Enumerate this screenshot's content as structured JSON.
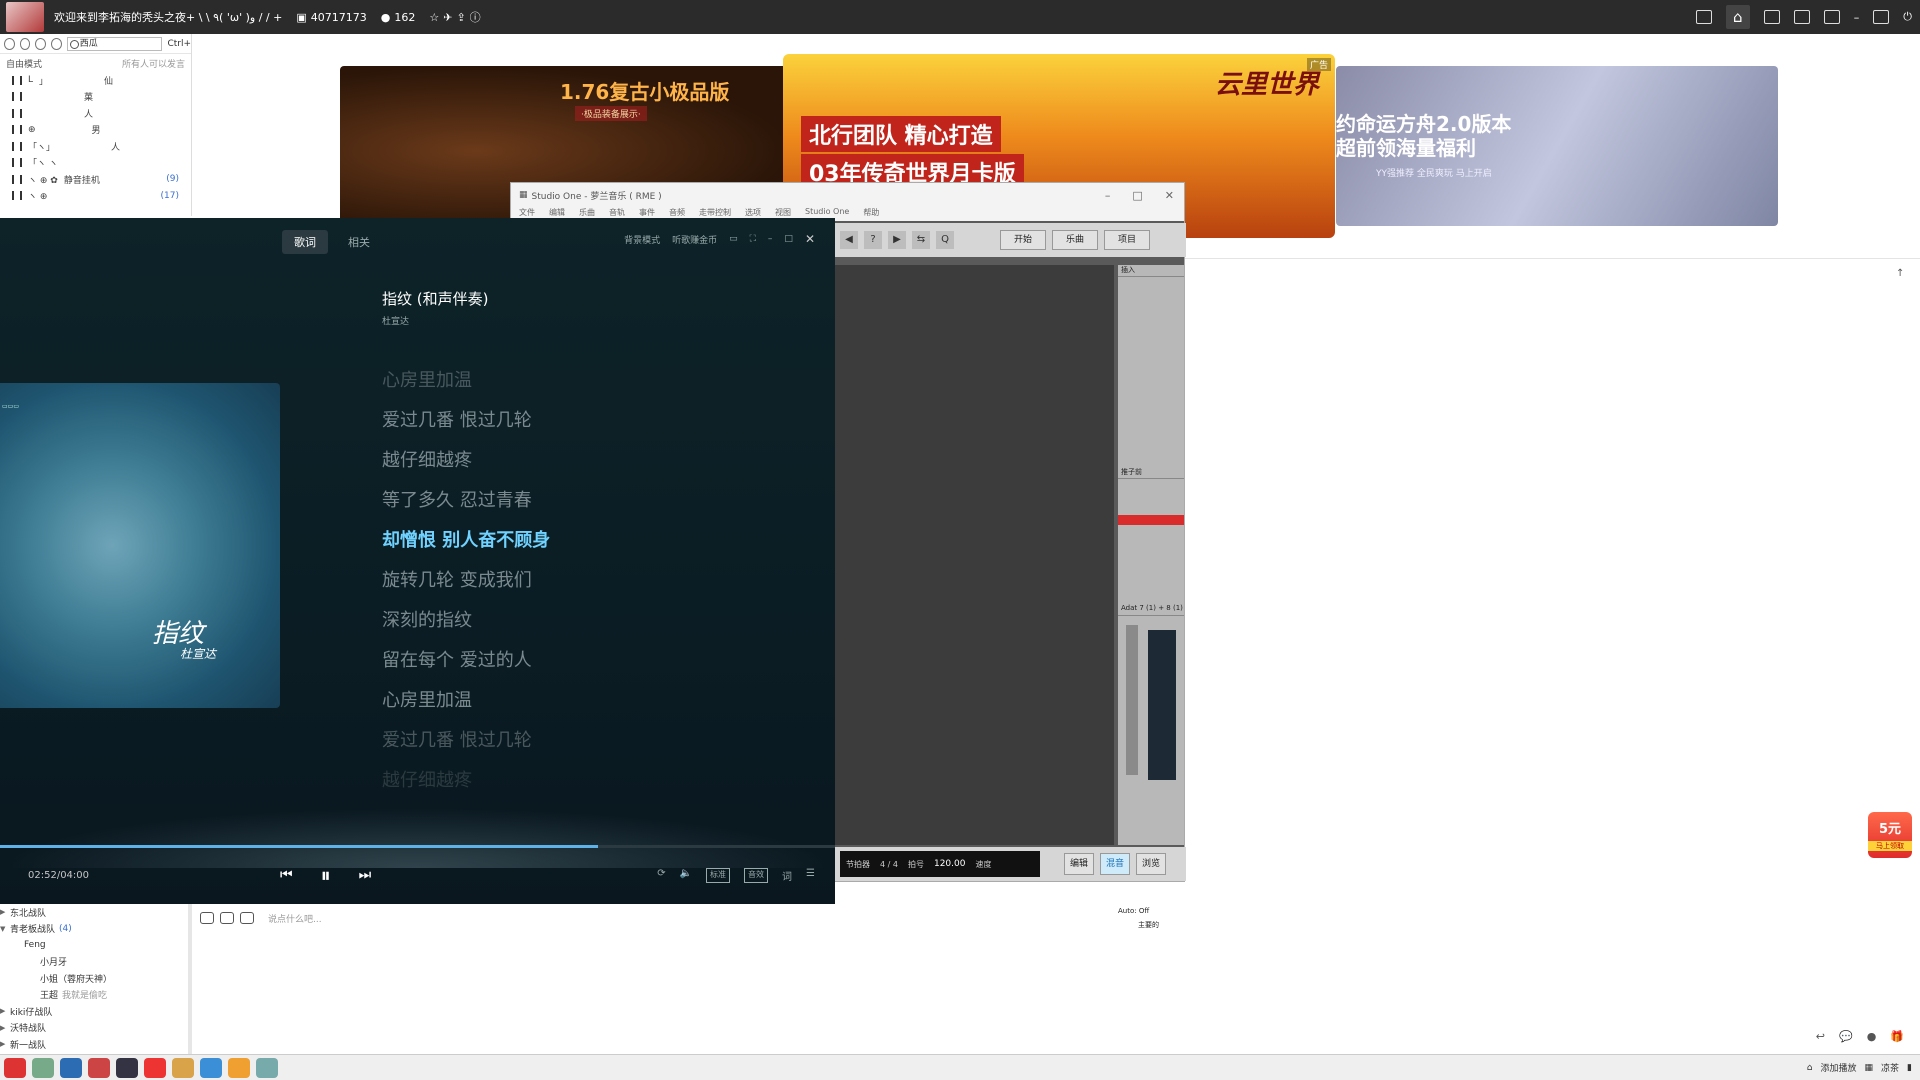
{
  "topbar": {
    "title": "欢迎来到李拓海的秃头之夜+ \\ \\ ٩( 'ω' )و / / +",
    "room_id": "40717173",
    "viewers": "162",
    "icons": [
      "screen-record-icon",
      "home-icon",
      "list-icon",
      "game-icon",
      "download-icon",
      "minimize-icon",
      "restore-icon",
      "power-icon"
    ]
  },
  "leftpanel": {
    "search_text": "西瓜",
    "search_shortcut": "Ctrl+",
    "mode_label": "自由模式",
    "mode_hint": "所有人可以发言",
    "rows": [
      {
        "c1": "L",
        "c2": "」",
        "c3": "仙",
        "cnt": ""
      },
      {
        "c1": "",
        "c2": "",
        "c3": "菓",
        "cnt": ""
      },
      {
        "c1": "",
        "c2": "",
        "c3": "人",
        "cnt": ""
      },
      {
        "c1": "⊕",
        "c2": "",
        "c3": "男",
        "cnt": ""
      },
      {
        "c1": "「ヽ」",
        "c2": "",
        "c3": "人",
        "cnt": ""
      },
      {
        "c1": "「ヽ  ヽ",
        "c2": "",
        "c3": "",
        "cnt": ""
      },
      {
        "c1": "ヽ ⊕ ✿",
        "c2": "静音挂机",
        "c3": "",
        "cnt": "(9)"
      },
      {
        "c1": "ヽ ⊕",
        "c2": "",
        "c3": "",
        "cnt": "(17)"
      }
    ]
  },
  "ads": {
    "ad1_title": "1.76复古小极品版",
    "ad1_sub": "·极品装备展示·",
    "ad2_line1": "北行团队  精心打造",
    "ad2_line2": "03年传奇世界月卡版",
    "ad2_logo": "云里世界",
    "ad2_close": "广告",
    "ad3_title": "约命运方舟2.0版本\n超前领海量福利",
    "ad3_sub": "YY强推荐 全民爽玩 马上开启"
  },
  "studio": {
    "title": "Studio One - 萝兰音乐 ( RME )",
    "menu": [
      "文件",
      "编辑",
      "乐曲",
      "音轨",
      "事件",
      "音频",
      "走带控制",
      "选项",
      "视图",
      "Studio One",
      "帮助"
    ],
    "tool_buttons": [
      "开始",
      "乐曲",
      "项目"
    ],
    "insert_label": "插入",
    "send_label": "推子前",
    "channel_label": "Adat 7 (1) + 8 (1)",
    "auto_label": "Auto: Off",
    "main_label": "主要的",
    "time_sig": "4 / 4",
    "tempo": "120.00",
    "tempo_label": "速度",
    "sig_label": "拍号",
    "metronome_label": "节拍器",
    "bottom_buttons": [
      "编辑",
      "混音",
      "浏览"
    ],
    "active_bottom": "混音"
  },
  "player": {
    "tab_lyrics": "歌词",
    "tab_related": "相关",
    "bg_mode": "背景模式",
    "earn": "听歌赚金币",
    "song_title": "指纹 (和声伴奏)",
    "artist": "杜宣达",
    "cover_text": "指纹",
    "cover_artist": "杜宣达",
    "lyrics": [
      "心房里加温",
      "爱过几番 恨过几轮",
      "越仔细越疼",
      "等了多久 忍过青春",
      "却憎恨 别人奋不顾身",
      "旋转几轮 变成我们",
      "深刻的指纹",
      "留在每个 爱过的人",
      "心房里加温",
      "爱过几番 恨过几轮",
      "越仔细越疼"
    ],
    "current_index": 4,
    "time": "02:52/04:00",
    "progress": 0.716,
    "right_controls": [
      "标准",
      "音效",
      "词"
    ]
  },
  "chatlist": {
    "items": [
      {
        "label": "东北战队",
        "cnt": ""
      },
      {
        "label": "青老板战队",
        "cnt": "(4)"
      },
      {
        "label": "Feng",
        "cnt": ""
      },
      {
        "label": "小月牙",
        "cnt": ""
      },
      {
        "label": "小姐（蓉府天神）",
        "cnt": ""
      },
      {
        "label": "王超",
        "cnt": "我就是偷吃"
      },
      {
        "label": "kiki仔战队",
        "cnt": ""
      },
      {
        "label": "沃特战队",
        "cnt": ""
      },
      {
        "label": "新一战队",
        "cnt": ""
      }
    ]
  },
  "chatbox": {
    "placeholder": "说点什么吧..."
  },
  "promo": {
    "price": "5元",
    "label": "马上领取"
  },
  "taskbar": {
    "tray_text": "添加播放",
    "tray_text2": "凉茶"
  }
}
